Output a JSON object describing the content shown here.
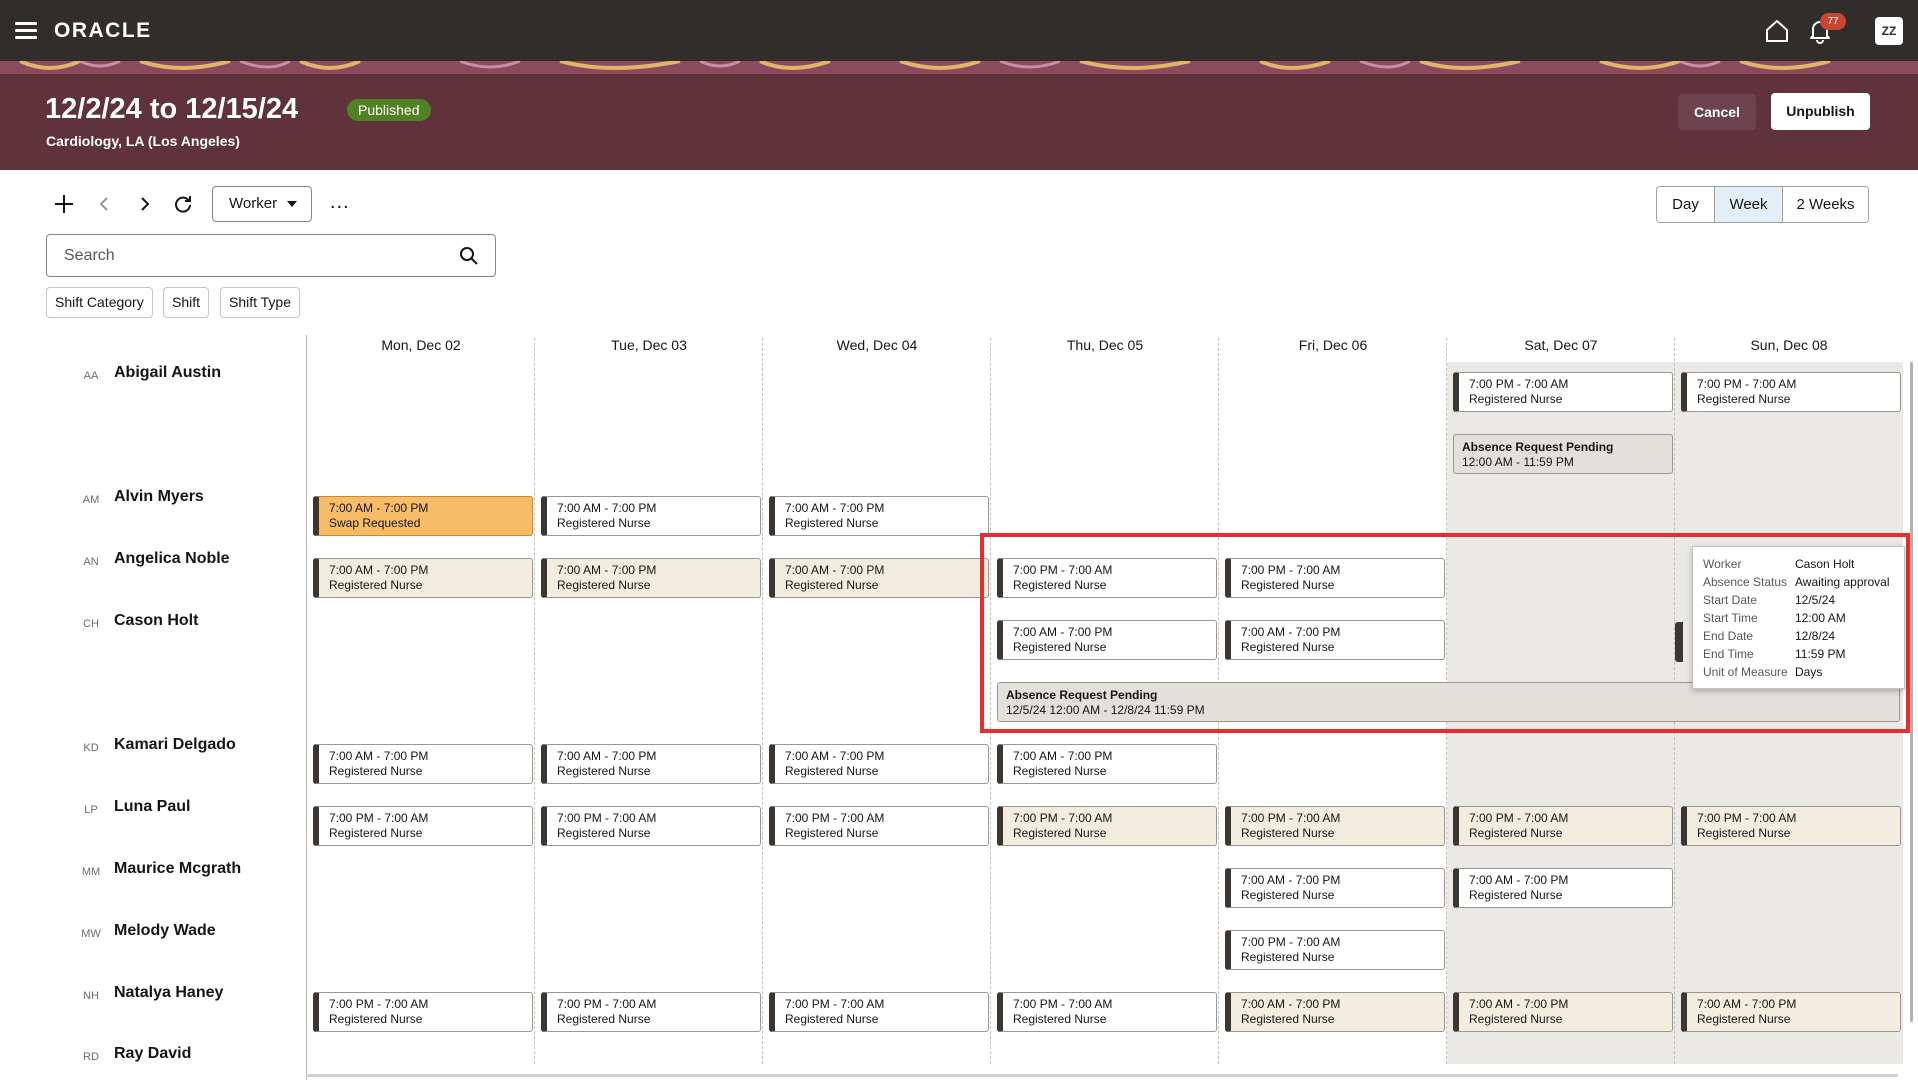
{
  "topbar": {
    "logo": "ORACLE",
    "notification_count": "77",
    "user_initials": "ZZ"
  },
  "header": {
    "title": "12/2/24 to 12/15/24",
    "status": "Published",
    "location": "Cardiology, LA (Los Angeles)",
    "cancel_label": "Cancel",
    "unpublish_label": "Unpublish"
  },
  "toolbar": {
    "view_by": "Worker",
    "more": "...",
    "ranges": [
      "Day",
      "Week",
      "2 Weeks"
    ],
    "active_range": "Week"
  },
  "search": {
    "placeholder": "Search"
  },
  "filters": [
    "Shift Category",
    "Shift",
    "Shift Type"
  ],
  "days": [
    "Mon, Dec 02",
    "Tue, Dec 03",
    "Wed, Dec 04",
    "Thu, Dec 05",
    "Fri, Dec 06",
    "Sat, Dec 07",
    "Sun, Dec 08"
  ],
  "workers": [
    {
      "initials": "AA",
      "name": "Abigail Austin"
    },
    {
      "initials": "AM",
      "name": "Alvin Myers"
    },
    {
      "initials": "AN",
      "name": "Angelica Noble"
    },
    {
      "initials": "CH",
      "name": "Cason Holt"
    },
    {
      "initials": "KD",
      "name": "Kamari Delgado"
    },
    {
      "initials": "LP",
      "name": "Luna Paul"
    },
    {
      "initials": "MM",
      "name": "Maurice Mcgrath"
    },
    {
      "initials": "MW",
      "name": "Melody Wade"
    },
    {
      "initials": "NH",
      "name": "Natalya Haney"
    },
    {
      "initials": "RD",
      "name": "Ray David"
    }
  ],
  "shifts": [
    {
      "row": 0,
      "day": 5,
      "line": 0,
      "time": "7:00 PM - 7:00 AM",
      "role": "Registered Nurse",
      "style": "white"
    },
    {
      "row": 0,
      "day": 6,
      "line": 0,
      "time": "7:00 PM - 7:00 AM",
      "role": "Registered Nurse",
      "style": "white"
    },
    {
      "row": 1,
      "day": 0,
      "line": 0,
      "time": "7:00 AM - 7:00 PM",
      "role": "Swap Requested",
      "style": "orange"
    },
    {
      "row": 1,
      "day": 1,
      "line": 0,
      "time": "7:00 AM - 7:00 PM",
      "role": "Registered Nurse",
      "style": "white"
    },
    {
      "row": 1,
      "day": 2,
      "line": 0,
      "time": "7:00 AM - 7:00 PM",
      "role": "Registered Nurse",
      "style": "white"
    },
    {
      "row": 2,
      "day": 0,
      "line": 0,
      "time": "7:00 AM - 7:00 PM",
      "role": "Registered Nurse",
      "style": "beige"
    },
    {
      "row": 2,
      "day": 1,
      "line": 0,
      "time": "7:00 AM - 7:00 PM",
      "role": "Registered Nurse",
      "style": "beige"
    },
    {
      "row": 2,
      "day": 2,
      "line": 0,
      "time": "7:00 AM - 7:00 PM",
      "role": "Registered Nurse",
      "style": "beige"
    },
    {
      "row": 2,
      "day": 3,
      "line": 0,
      "time": "7:00 PM - 7:00 AM",
      "role": "Registered Nurse",
      "style": "white"
    },
    {
      "row": 2,
      "day": 4,
      "line": 0,
      "time": "7:00 PM - 7:00 AM",
      "role": "Registered Nurse",
      "style": "white"
    },
    {
      "row": 3,
      "day": 3,
      "line": 0,
      "time": "7:00 AM - 7:00 PM",
      "role": "Registered Nurse",
      "style": "white"
    },
    {
      "row": 3,
      "day": 4,
      "line": 0,
      "time": "7:00 AM - 7:00 PM",
      "role": "Registered Nurse",
      "style": "white"
    },
    {
      "row": 4,
      "day": 0,
      "line": 0,
      "time": "7:00 AM - 7:00 PM",
      "role": "Registered Nurse",
      "style": "white"
    },
    {
      "row": 4,
      "day": 1,
      "line": 0,
      "time": "7:00 AM - 7:00 PM",
      "role": "Registered Nurse",
      "style": "white"
    },
    {
      "row": 4,
      "day": 2,
      "line": 0,
      "time": "7:00 AM - 7:00 PM",
      "role": "Registered Nurse",
      "style": "white"
    },
    {
      "row": 4,
      "day": 3,
      "line": 0,
      "time": "7:00 AM - 7:00 PM",
      "role": "Registered Nurse",
      "style": "white"
    },
    {
      "row": 5,
      "day": 0,
      "line": 0,
      "time": "7:00 PM - 7:00 AM",
      "role": "Registered Nurse",
      "style": "white"
    },
    {
      "row": 5,
      "day": 1,
      "line": 0,
      "time": "7:00 PM - 7:00 AM",
      "role": "Registered Nurse",
      "style": "white"
    },
    {
      "row": 5,
      "day": 2,
      "line": 0,
      "time": "7:00 PM - 7:00 AM",
      "role": "Registered Nurse",
      "style": "white"
    },
    {
      "row": 5,
      "day": 3,
      "line": 0,
      "time": "7:00 PM - 7:00 AM",
      "role": "Registered Nurse",
      "style": "beige"
    },
    {
      "row": 5,
      "day": 4,
      "line": 0,
      "time": "7:00 PM - 7:00 AM",
      "role": "Registered Nurse",
      "style": "beige"
    },
    {
      "row": 5,
      "day": 5,
      "line": 0,
      "time": "7:00 PM - 7:00 AM",
      "role": "Registered Nurse",
      "style": "beige"
    },
    {
      "row": 5,
      "day": 6,
      "line": 0,
      "time": "7:00 PM - 7:00 AM",
      "role": "Registered Nurse",
      "style": "beige"
    },
    {
      "row": 6,
      "day": 4,
      "line": 0,
      "time": "7:00 AM - 7:00 PM",
      "role": "Registered Nurse",
      "style": "white"
    },
    {
      "row": 6,
      "day": 5,
      "line": 0,
      "time": "7:00 AM - 7:00 PM",
      "role": "Registered Nurse",
      "style": "white"
    },
    {
      "row": 7,
      "day": 4,
      "line": 0,
      "time": "7:00 PM - 7:00 AM",
      "role": "Registered Nurse",
      "style": "white"
    },
    {
      "row": 8,
      "day": 0,
      "line": 0,
      "time": "7:00 PM - 7:00 AM",
      "role": "Registered Nurse",
      "style": "white"
    },
    {
      "row": 8,
      "day": 1,
      "line": 0,
      "time": "7:00 PM - 7:00 AM",
      "role": "Registered Nurse",
      "style": "white"
    },
    {
      "row": 8,
      "day": 2,
      "line": 0,
      "time": "7:00 PM - 7:00 AM",
      "role": "Registered Nurse",
      "style": "white"
    },
    {
      "row": 8,
      "day": 3,
      "line": 0,
      "time": "7:00 PM - 7:00 AM",
      "role": "Registered Nurse",
      "style": "white"
    },
    {
      "row": 8,
      "day": 4,
      "line": 0,
      "time": "7:00 AM - 7:00 PM",
      "role": "Registered Nurse",
      "style": "beige"
    },
    {
      "row": 8,
      "day": 5,
      "line": 0,
      "time": "7:00 AM - 7:00 PM",
      "role": "Registered Nurse",
      "style": "beige"
    },
    {
      "row": 8,
      "day": 6,
      "line": 0,
      "time": "7:00 AM - 7:00 PM",
      "role": "Registered Nurse",
      "style": "beige"
    }
  ],
  "absences": [
    {
      "title": "Absence Request Pending",
      "time": "12:00 AM - 11:59 PM"
    },
    {
      "title": "Absence Request Pending",
      "time": "12/5/24 12:00 AM - 12/8/24 11:59 PM"
    }
  ],
  "tooltip": {
    "rows": [
      {
        "label": "Worker",
        "value": "Cason Holt"
      },
      {
        "label": "Absence Status",
        "value": "Awaiting approval"
      },
      {
        "label": "Start Date",
        "value": "12/5/24"
      },
      {
        "label": "Start Time",
        "value": "12:00 AM"
      },
      {
        "label": "End Date",
        "value": "12/8/24"
      },
      {
        "label": "End Time",
        "value": "11:59 PM"
      },
      {
        "label": "Unit of Measure",
        "value": "Days"
      }
    ]
  }
}
